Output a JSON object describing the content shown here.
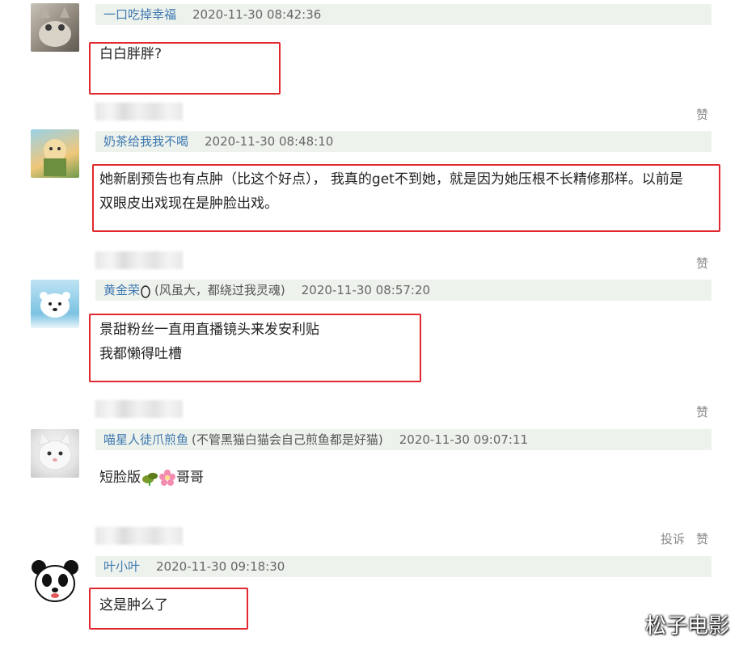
{
  "comments": [
    {
      "user": "一口吃掉幸福",
      "signature": "",
      "time": "2020-11-30 08:42:36",
      "lines": [
        "白白胖胖?"
      ],
      "actions": [
        "赞"
      ]
    },
    {
      "user": "奶茶给我我不喝",
      "signature": "",
      "time": "2020-11-30 08:48:10",
      "lines": [
        "她新剧预告也有点肿（比这个好点）， 我真的get不到她，就是因为她压根不长精修那样。以前是",
        "双眼皮出戏现在是肿脸出戏。"
      ],
      "actions": [
        "赞"
      ]
    },
    {
      "user": "黄金荣",
      "signature": "(风虽大，都绕过我灵魂)",
      "time": "2020-11-30 08:57:20",
      "lines": [
        "景甜粉丝一直用直播镜头来发安利贴",
        "我都懒得吐槽"
      ],
      "actions": [
        "赞"
      ]
    },
    {
      "user": "喵星人徒爪煎鱼",
      "signature": "(不管黑猫白猫会自己煎鱼都是好猫)",
      "time": "2020-11-30 09:07:11",
      "lines": [
        "短脸版",
        "哥哥"
      ],
      "actions": [
        "投诉",
        "赞"
      ]
    },
    {
      "user": "叶小叶",
      "signature": "",
      "time": "2020-11-30 09:18:30",
      "lines": [
        "这是肿么了"
      ],
      "actions": []
    }
  ],
  "watermark": "松子电影",
  "icons": {
    "egg": "egg-icon",
    "leaf": "leaf-emoji-icon",
    "flower": "flower-emoji-icon"
  }
}
